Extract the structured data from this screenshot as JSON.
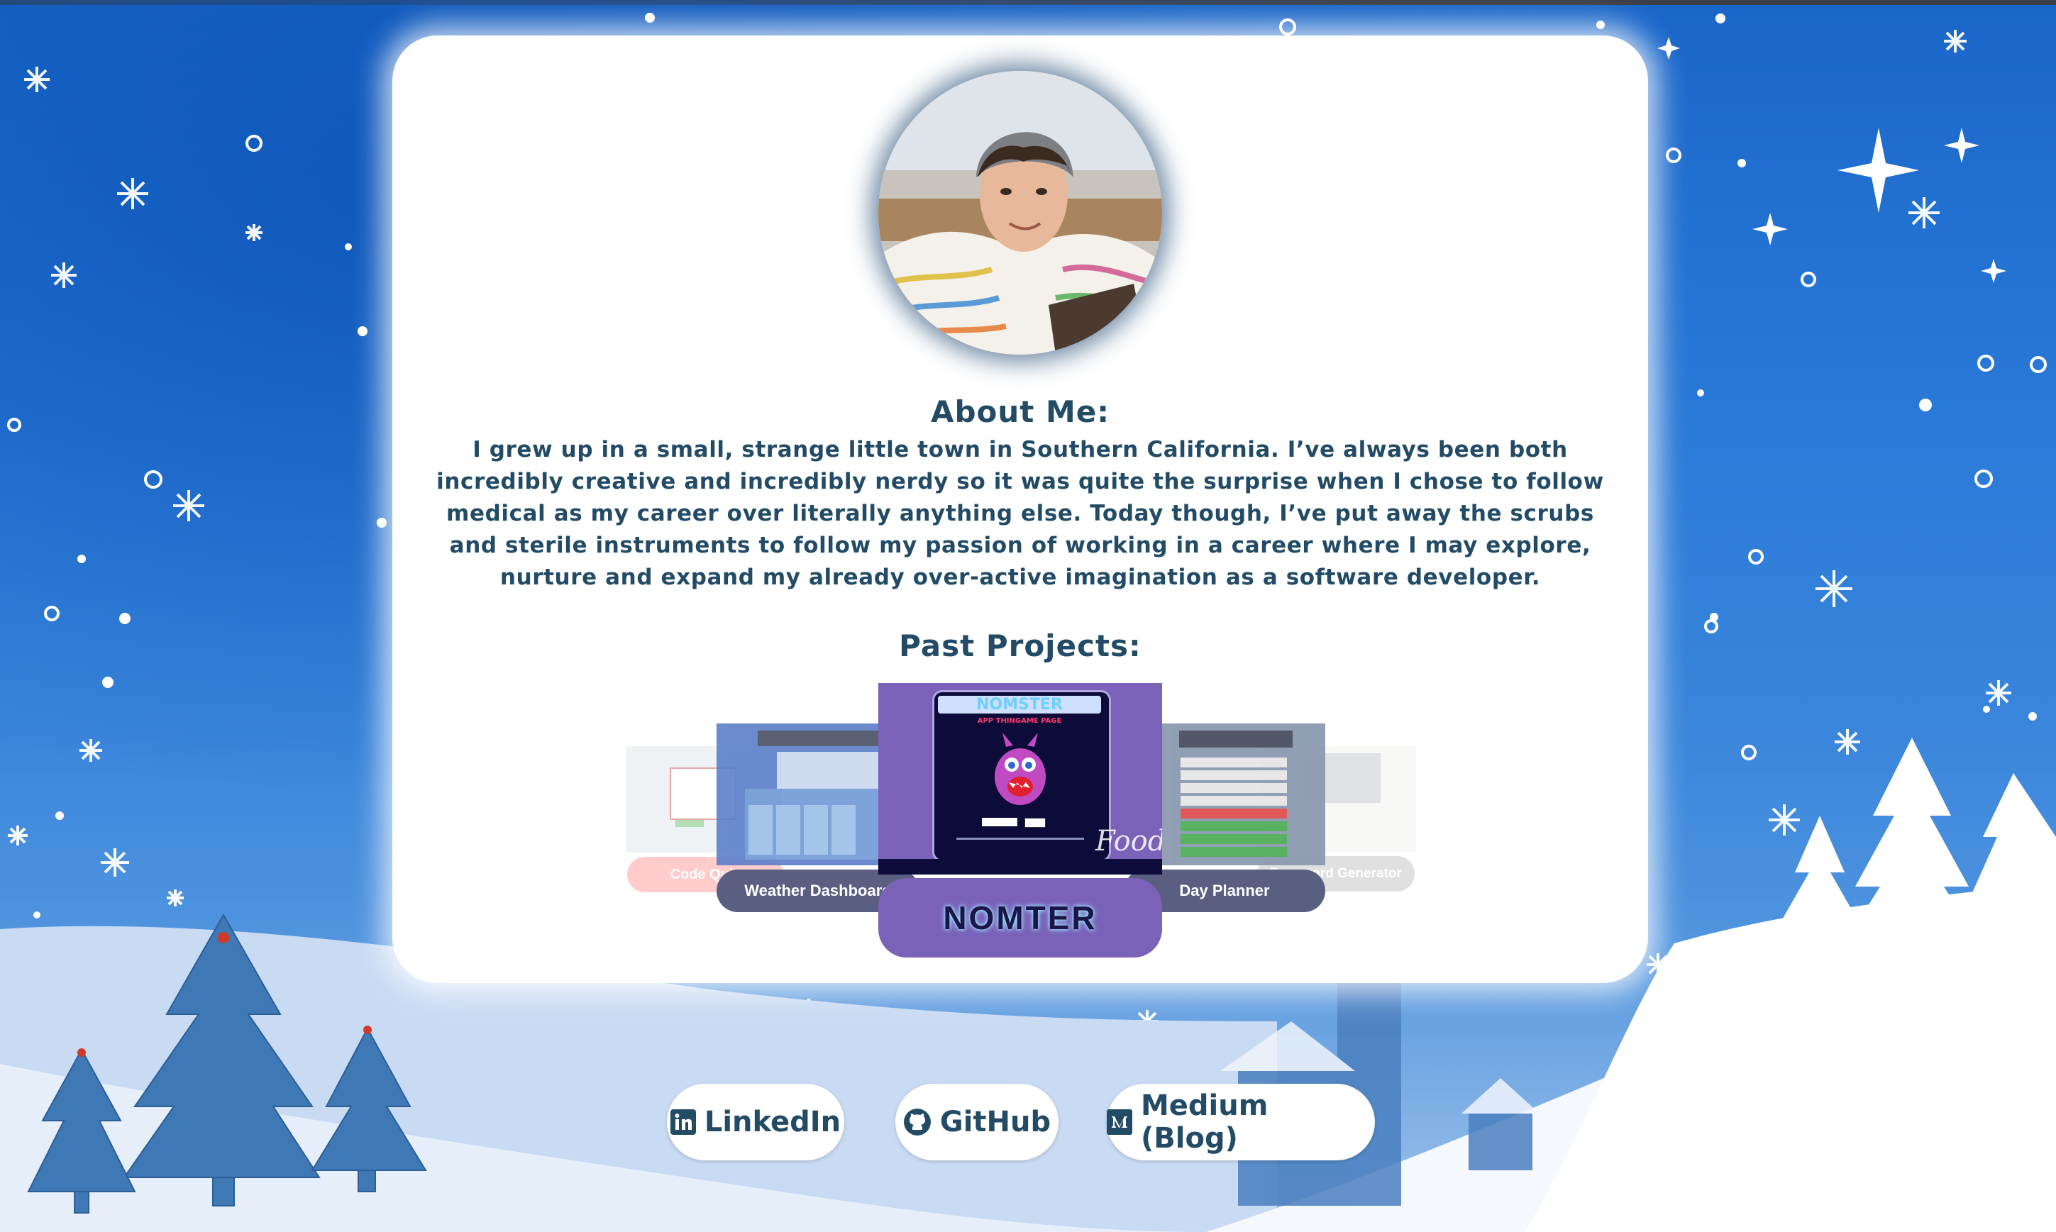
{
  "about": {
    "title": "About Me:",
    "text": "I grew up in a small, strange little town in Southern California. I’ve always been both incredibly creative and incredibly nerdy so it was quite the surprise when I chose to follow medical as my career over literally anything else. Today though, I’ve put away the scrubs and sterile instruments to follow my passion of working in a career where I may explore, nurture and expand my already over-active imagination as a software developer."
  },
  "projects": {
    "title": "Past Projects:",
    "items": [
      {
        "label": "Code Quiz"
      },
      {
        "label": "Weather Dashboard"
      },
      {
        "label": "NOMTER",
        "screen_title": "NOMSTER",
        "screen_subtitle": "APP THINGAME PAGE",
        "screen_word": "Food"
      },
      {
        "label": "Day Planner"
      },
      {
        "label": "Password Generator"
      }
    ]
  },
  "social": {
    "linkedin": "LinkedIn",
    "github": "GitHub",
    "medium": "Medium (Blog)"
  },
  "colors": {
    "accent": "#234b66",
    "nomter_purple": "#7a62b8",
    "label_dark": "#5a5e80",
    "sky": "#2a7ad8"
  }
}
